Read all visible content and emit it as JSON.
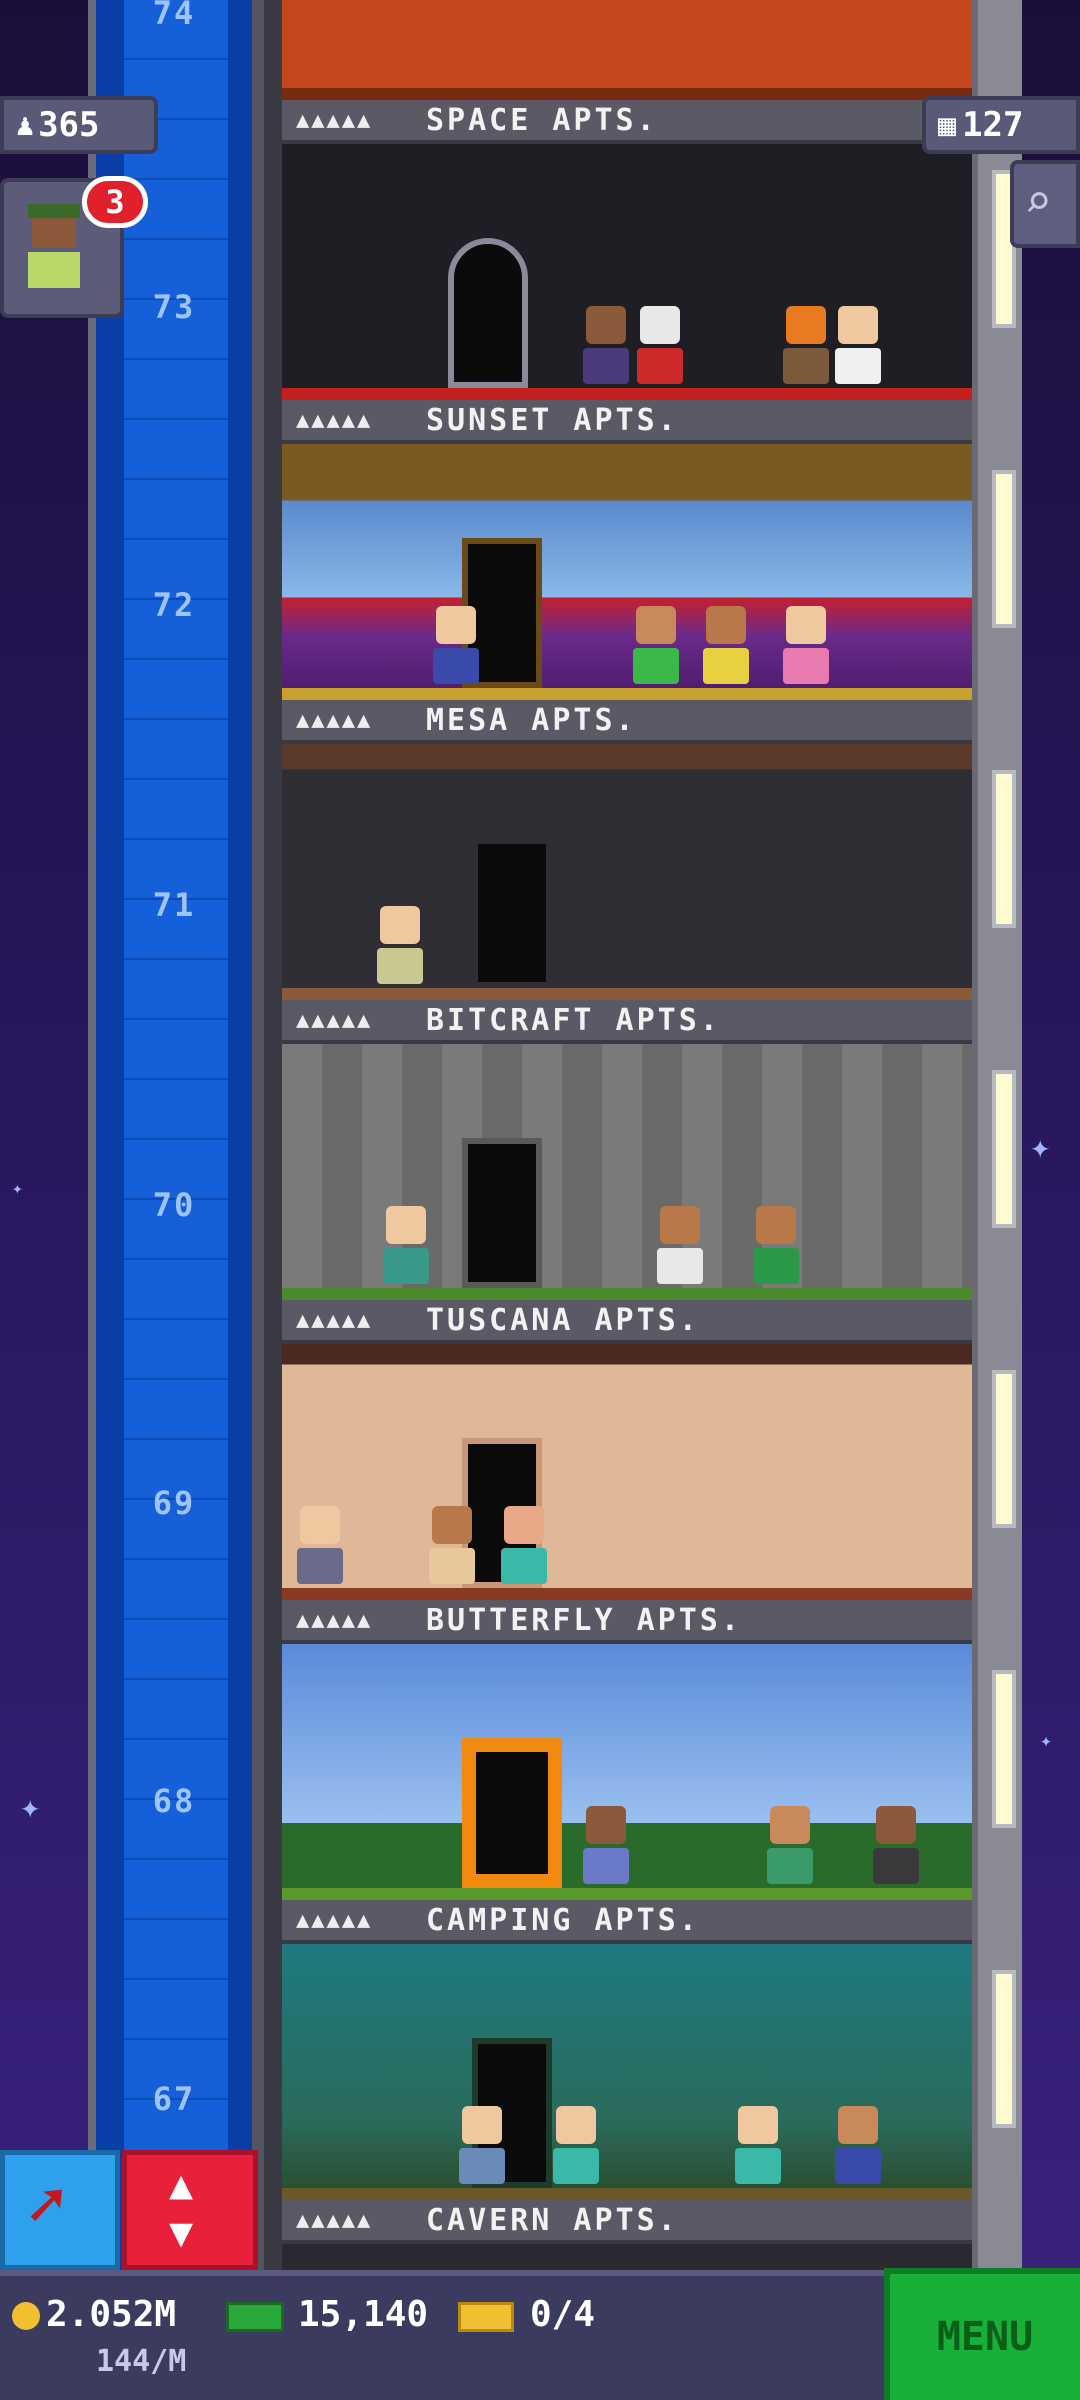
{
  "hud": {
    "population": "365",
    "floors_count": "127",
    "notification_count": "3"
  },
  "top_floor_number": "74",
  "floors": [
    {
      "number": "73",
      "sign": "SPACE APTS.",
      "stars": "▲▲▲▲▲"
    },
    {
      "number": "72",
      "sign": "SUNSET APTS.",
      "stars": "▲▲▲▲▲"
    },
    {
      "number": "71",
      "sign": "MESA APTS.",
      "stars": "▲▲▲▲▲"
    },
    {
      "number": "70",
      "sign": "BITCRAFT APTS.",
      "stars": "▲▲▲▲▲"
    },
    {
      "number": "69",
      "sign": "TUSCANA APTS.",
      "stars": "▲▲▲▲▲"
    },
    {
      "number": "68",
      "sign": "BUTTERFLY APTS.",
      "stars": "▲▲▲▲▲"
    },
    {
      "number": "67",
      "sign": "CAMPING APTS.",
      "stars": "▲▲▲▲▲"
    },
    {
      "number": "",
      "sign": "CAVERN APTS.",
      "stars": "▲▲▲▲▲"
    }
  ],
  "bottom_bar": {
    "coins": "2.052M",
    "coin_rate": "144/M",
    "bux": "15,140",
    "tickets": "0/4",
    "menu_label": "MENU"
  },
  "colors": {
    "shaft": "#1560d8",
    "menu": "#19b03a",
    "elevator_button": "#e8203a",
    "build_button": "#2fa0ee"
  }
}
